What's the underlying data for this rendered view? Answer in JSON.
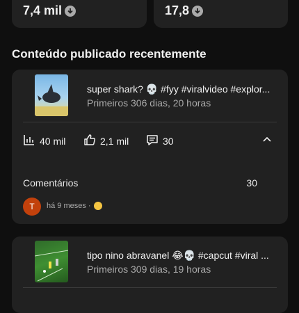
{
  "stats": [
    {
      "value": "7,4 mil",
      "icon": "arrow-down-circle-icon"
    },
    {
      "value": "17,8",
      "icon": "arrow-down-circle-icon"
    }
  ],
  "section": {
    "title": "Conteúdo publicado recentemente"
  },
  "videos": [
    {
      "title": "super shark? 💀 #fyy #viralvideo #explor...",
      "meta": "Primeiros 306 dias, 20 horas",
      "views": "40 mil",
      "likes": "2,1 mil",
      "comments": "30",
      "comments_label": "Comentários",
      "comments_count": "30",
      "comment": {
        "avatar_letter": "T",
        "time": "há 9 meses ·"
      }
    },
    {
      "title": "tipo nino abravanel 😂💀 #capcut #viral ...",
      "meta": "Primeiros 309 dias, 19 horas"
    }
  ],
  "colors": {
    "background": "#0f0f0f",
    "card": "#212121",
    "secondary_text": "#aaaaaa",
    "avatar": "#c2410c"
  }
}
